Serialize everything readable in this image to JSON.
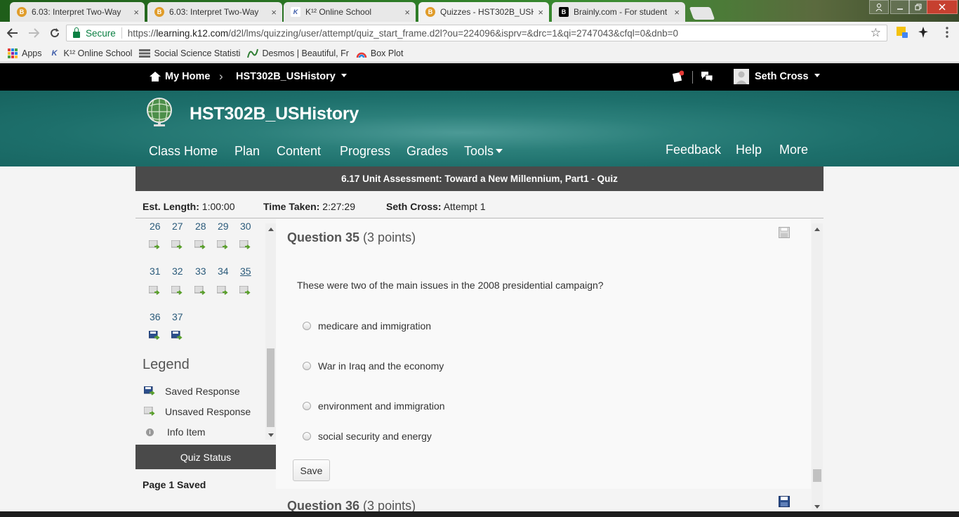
{
  "browser": {
    "tabs": [
      {
        "title": "6.03: Interpret Two-Way",
        "icon": "orange-b-favicon"
      },
      {
        "title": "6.03: Interpret Two-Way",
        "icon": "orange-b-favicon"
      },
      {
        "title": "K¹² Online School",
        "icon": "k12-favicon"
      },
      {
        "title": "Quizzes - HST302B_USHi",
        "icon": "orange-b-favicon"
      },
      {
        "title": "Brainly.com - For student",
        "icon": "brainly-favicon"
      }
    ],
    "close_glyph": "×",
    "secure_label": "Secure",
    "url_prefix": "https://",
    "url_host": "learning.k12.com",
    "url_path": "/d2l/lms/quizzing/user/attempt/quiz_start_frame.d2l?ou=224096&isprv=&drc=1&qi=2747043&cfql=0&dnb=0",
    "bookmarks": [
      {
        "label": "Apps"
      },
      {
        "label": "K¹² Online School"
      },
      {
        "label": "Social Science Statisti"
      },
      {
        "label": "Desmos | Beautiful, Fr"
      },
      {
        "label": "Box Plot"
      }
    ]
  },
  "site": {
    "home_label": "My Home",
    "course_menu": "HST302B_USHistory",
    "user_name": "Seth Cross",
    "course_title": "HST302B_USHistory",
    "nav": [
      "Class Home",
      "Plan",
      "Content",
      "Progress",
      "Grades",
      "Tools"
    ],
    "nav_right": [
      "Feedback",
      "Help",
      "More"
    ]
  },
  "quiz": {
    "title": "6.17 Unit Assessment: Toward a New Millennium, Part1 - Quiz",
    "est_length_label": "Est. Length:",
    "est_length_value": "1:00:00",
    "time_taken_label": "Time Taken:",
    "time_taken_value": "2:27:29",
    "attempt_user": "Seth Cross:",
    "attempt_value": "Attempt 1",
    "question_numbers": {
      "row1": [
        "26",
        "27",
        "28",
        "29",
        "30"
      ],
      "row2": [
        "31",
        "32",
        "33",
        "34",
        "35"
      ],
      "row3": [
        "36",
        "37"
      ]
    },
    "current_question": "35",
    "legend_title": "Legend",
    "legend": [
      "Saved Response",
      "Unsaved Response",
      "Info Item"
    ],
    "quiz_status_label": "Quiz Status",
    "page_saved": "Page 1 Saved",
    "question": {
      "label": "Question 35",
      "points": "(3 points)",
      "text": "These were two of the main issues in the 2008 presidential campaign?",
      "options": [
        "medicare and immigration",
        "War in Iraq and the economy",
        "environment and immigration",
        "social security and energy"
      ],
      "save_label": "Save"
    },
    "next_question": {
      "label": "Question 36",
      "points": "(3 points)"
    }
  },
  "colors": {
    "banner_teal": "#1d6f6b",
    "dark_bar": "#4a4a4a",
    "link_blue": "#2a5a7a",
    "secure_green": "#0b8043"
  }
}
